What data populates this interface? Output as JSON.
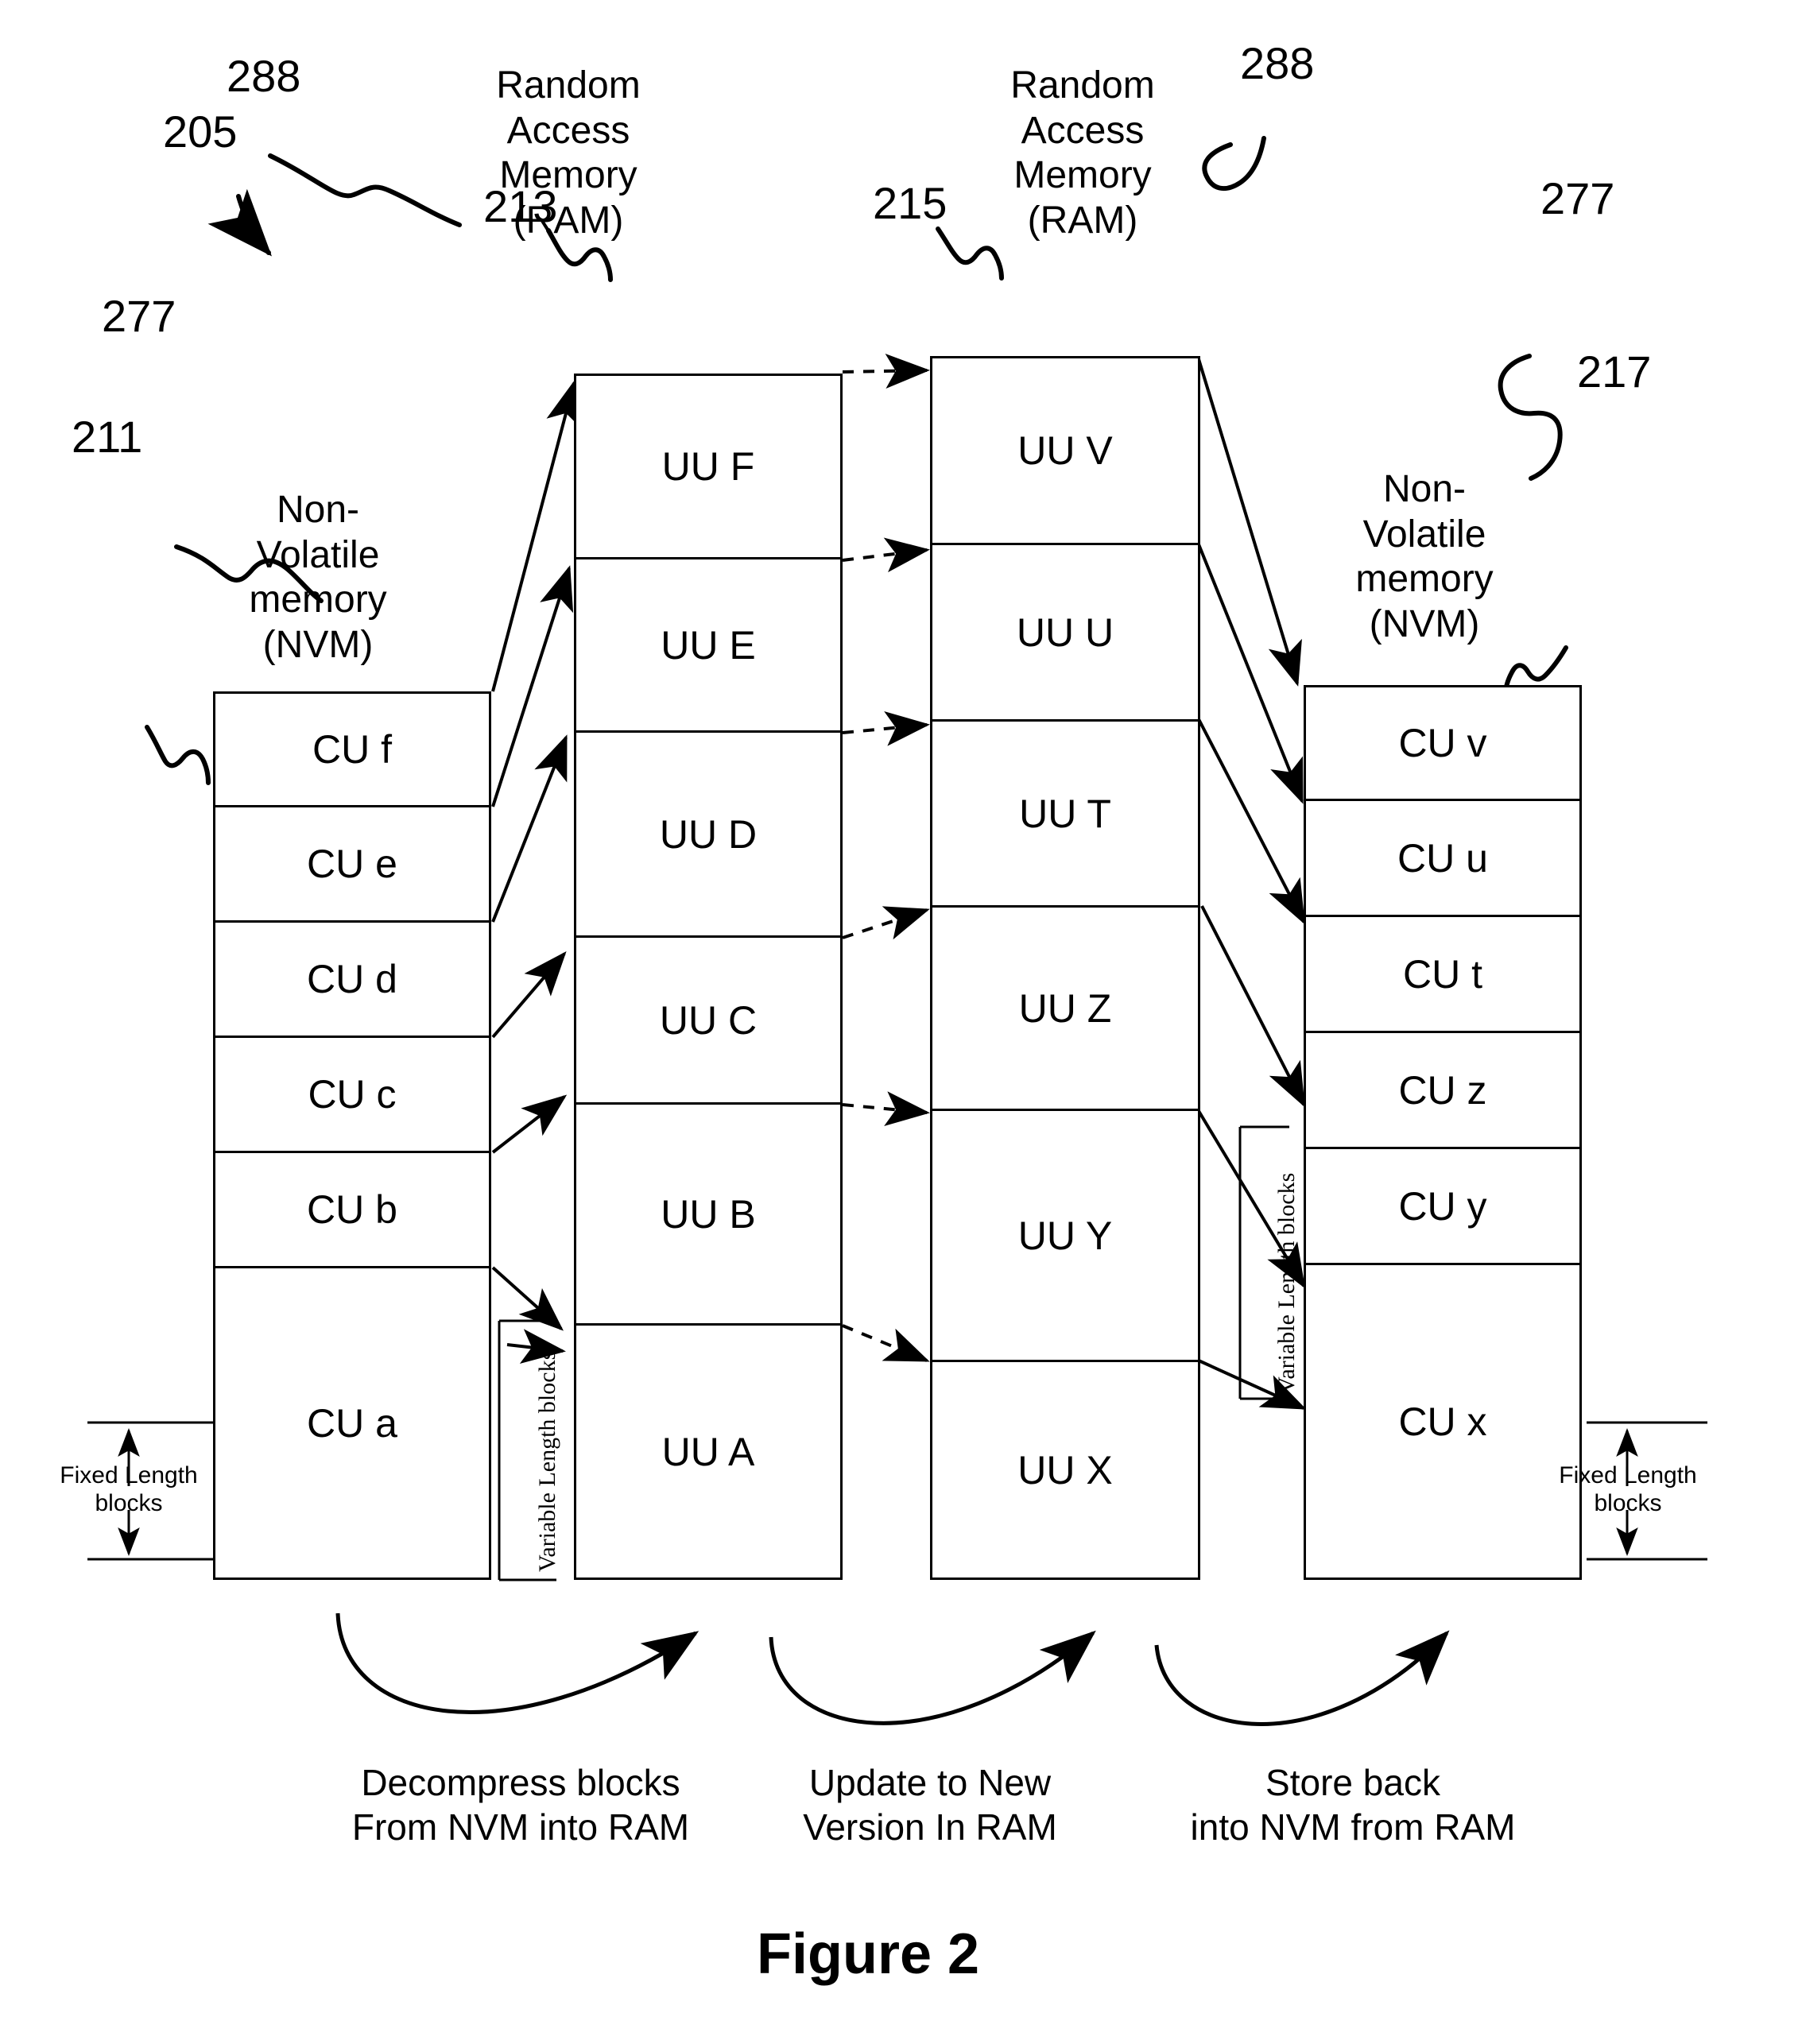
{
  "figure": {
    "title": "Figure 2",
    "overall_ref": "205"
  },
  "refs": {
    "overall": "205",
    "ram_left": "288",
    "ram_right": "288",
    "nvm_left": "277",
    "nvm_right": "277",
    "col_nvm_source": "211",
    "col_ram_decompressed": "213",
    "col_ram_updated": "215",
    "col_nvm_dest": "217"
  },
  "memory_labels": {
    "ram_left": "Random\nAccess\nMemory\n(RAM)",
    "ram_right": "Random\nAccess\nMemory\n(RAM)",
    "nvm_left": "Non-\nVolatile\nmemory\n(NVM)",
    "nvm_right": "Non-\nVolatile\nmemory\n(NVM)"
  },
  "columns": {
    "nvm_source": {
      "ref": "211",
      "kind": "Non-Volatile memory (NVM)",
      "block_type": "Fixed Length blocks",
      "blocks": [
        "CU f",
        "CU e",
        "CU d",
        "CU c",
        "CU b",
        "CU a"
      ]
    },
    "ram_decompressed": {
      "ref": "213",
      "kind": "Random Access Memory (RAM)",
      "block_type": "Variable Length blocks",
      "blocks": [
        "UU F",
        "UU E",
        "UU D",
        "UU C",
        "UU B",
        "UU A"
      ]
    },
    "ram_updated": {
      "ref": "215",
      "kind": "Random Access Memory (RAM)",
      "block_type": "Variable Length blocks",
      "blocks": [
        "UU V",
        "UU U",
        "UU T",
        "UU Z",
        "UU Y",
        "UU X"
      ]
    },
    "nvm_dest": {
      "ref": "217",
      "kind": "Non-Volatile memory (NVM)",
      "block_type": "Fixed Length blocks",
      "blocks": [
        "CU v",
        "CU u",
        "CU t",
        "CU z",
        "CU y",
        "CU x"
      ]
    }
  },
  "dimension_labels": {
    "fixed_left": "Fixed Length\nblocks",
    "fixed_right": "Fixed Length\nblocks",
    "variable_left": "Variable Length blocks",
    "variable_right": "Variable Length blocks"
  },
  "stage_captions": [
    {
      "id": "decompress",
      "text": "Decompress blocks\nFrom NVM into RAM"
    },
    {
      "id": "update",
      "text": "Update to New\nVersion In RAM"
    },
    {
      "id": "store",
      "text": "Store back\ninto NVM from RAM"
    }
  ]
}
